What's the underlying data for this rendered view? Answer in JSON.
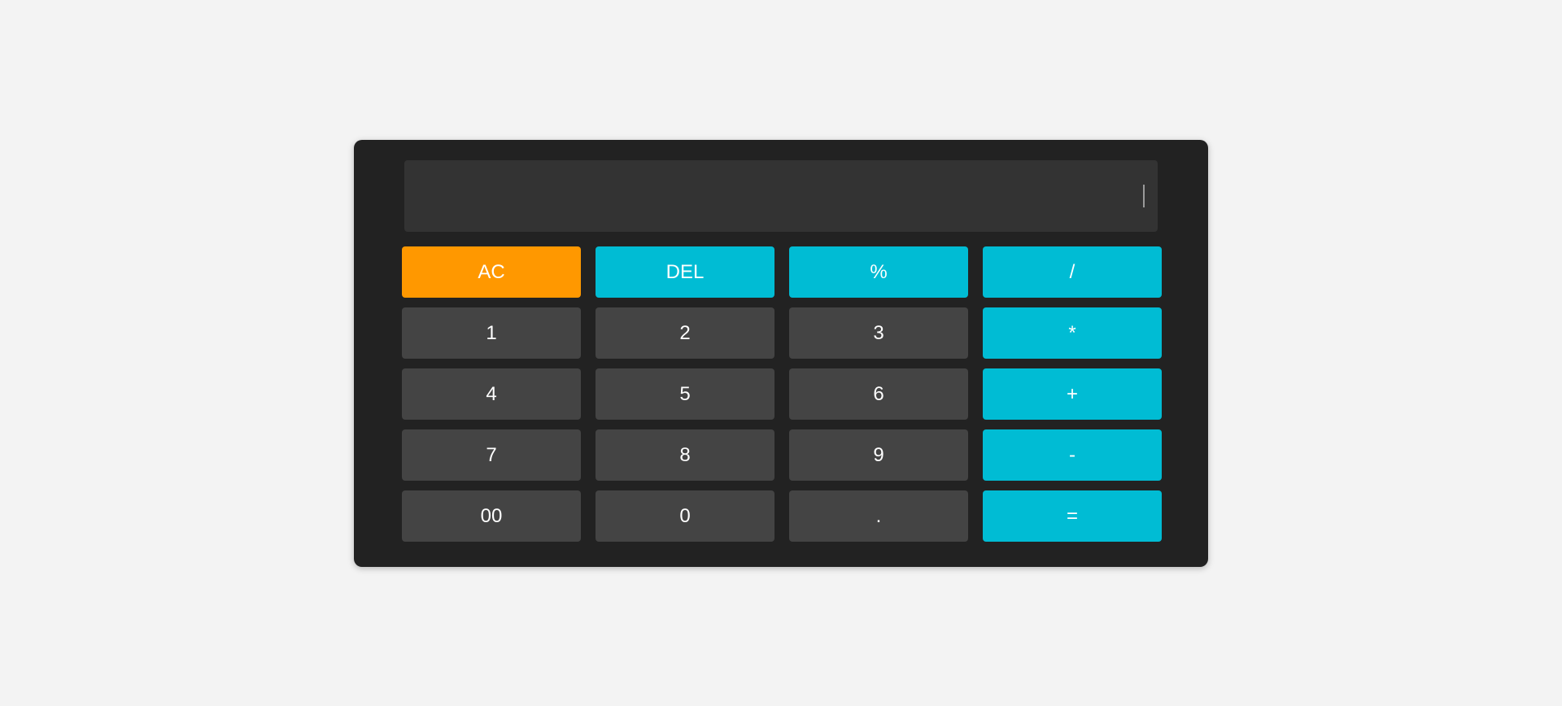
{
  "display": {
    "value": ""
  },
  "colors": {
    "page_background": "#f3f3f3",
    "body": "#222222",
    "display": "#333333",
    "number_key": "#444444",
    "operator_key": "#00bcd4",
    "clear_key": "#ff9800",
    "text": "#ffffff"
  },
  "keys": {
    "ac": "AC",
    "del": "DEL",
    "percent": "%",
    "divide": "/",
    "one": "1",
    "two": "2",
    "three": "3",
    "multiply": "*",
    "four": "4",
    "five": "5",
    "six": "6",
    "plus": "+",
    "seven": "7",
    "eight": "8",
    "nine": "9",
    "minus": "-",
    "double_zero": "00",
    "zero": "0",
    "decimal": ".",
    "equals": "="
  }
}
